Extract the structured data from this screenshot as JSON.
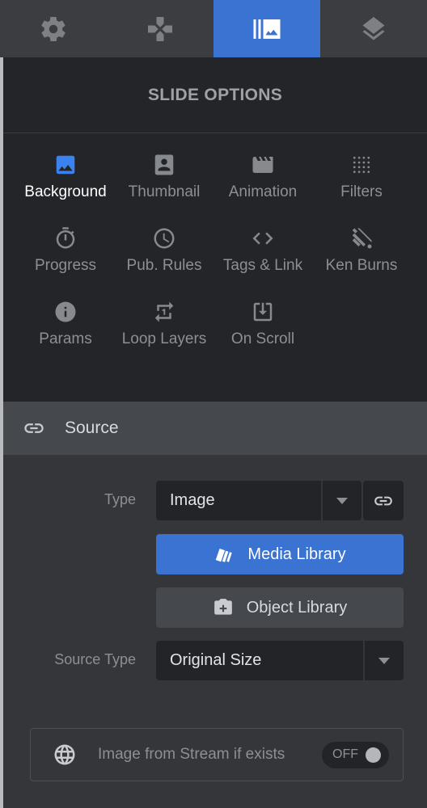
{
  "tabs": [
    {
      "icon": "gear-icon",
      "active": false
    },
    {
      "icon": "navigation-icon",
      "active": false
    },
    {
      "icon": "slide-image-icon",
      "active": true
    },
    {
      "icon": "layers-icon",
      "active": false
    }
  ],
  "options": {
    "title": "SLIDE OPTIONS",
    "items": [
      {
        "label": "Background",
        "icon": "image-icon",
        "active": true
      },
      {
        "label": "Thumbnail",
        "icon": "portrait-icon",
        "active": false
      },
      {
        "label": "Animation",
        "icon": "movie-icon",
        "active": false
      },
      {
        "label": "Filters",
        "icon": "grain-icon",
        "active": false
      },
      {
        "label": "Progress",
        "icon": "timer-icon",
        "active": false
      },
      {
        "label": "Pub. Rules",
        "icon": "clock-icon",
        "active": false
      },
      {
        "label": "Tags & Link",
        "icon": "code-icon",
        "active": false
      },
      {
        "label": "Ken Burns",
        "icon": "ken-burns-icon",
        "active": false
      },
      {
        "label": "Params",
        "icon": "info-icon",
        "active": false
      },
      {
        "label": "Loop Layers",
        "icon": "repeat-one-icon",
        "active": false
      },
      {
        "label": "On Scroll",
        "icon": "download-box-icon",
        "active": false
      }
    ]
  },
  "source": {
    "title": "Source",
    "type_label": "Type",
    "type_value": "Image",
    "media_library": "Media Library",
    "object_library": "Object Library",
    "source_type_label": "Source Type",
    "source_type_value": "Original Size",
    "stream_label": "Image from Stream if exists",
    "stream_toggle": "OFF"
  },
  "colors": {
    "accent": "#3a73d2",
    "panel_dark": "#242529",
    "panel": "#34363a"
  }
}
